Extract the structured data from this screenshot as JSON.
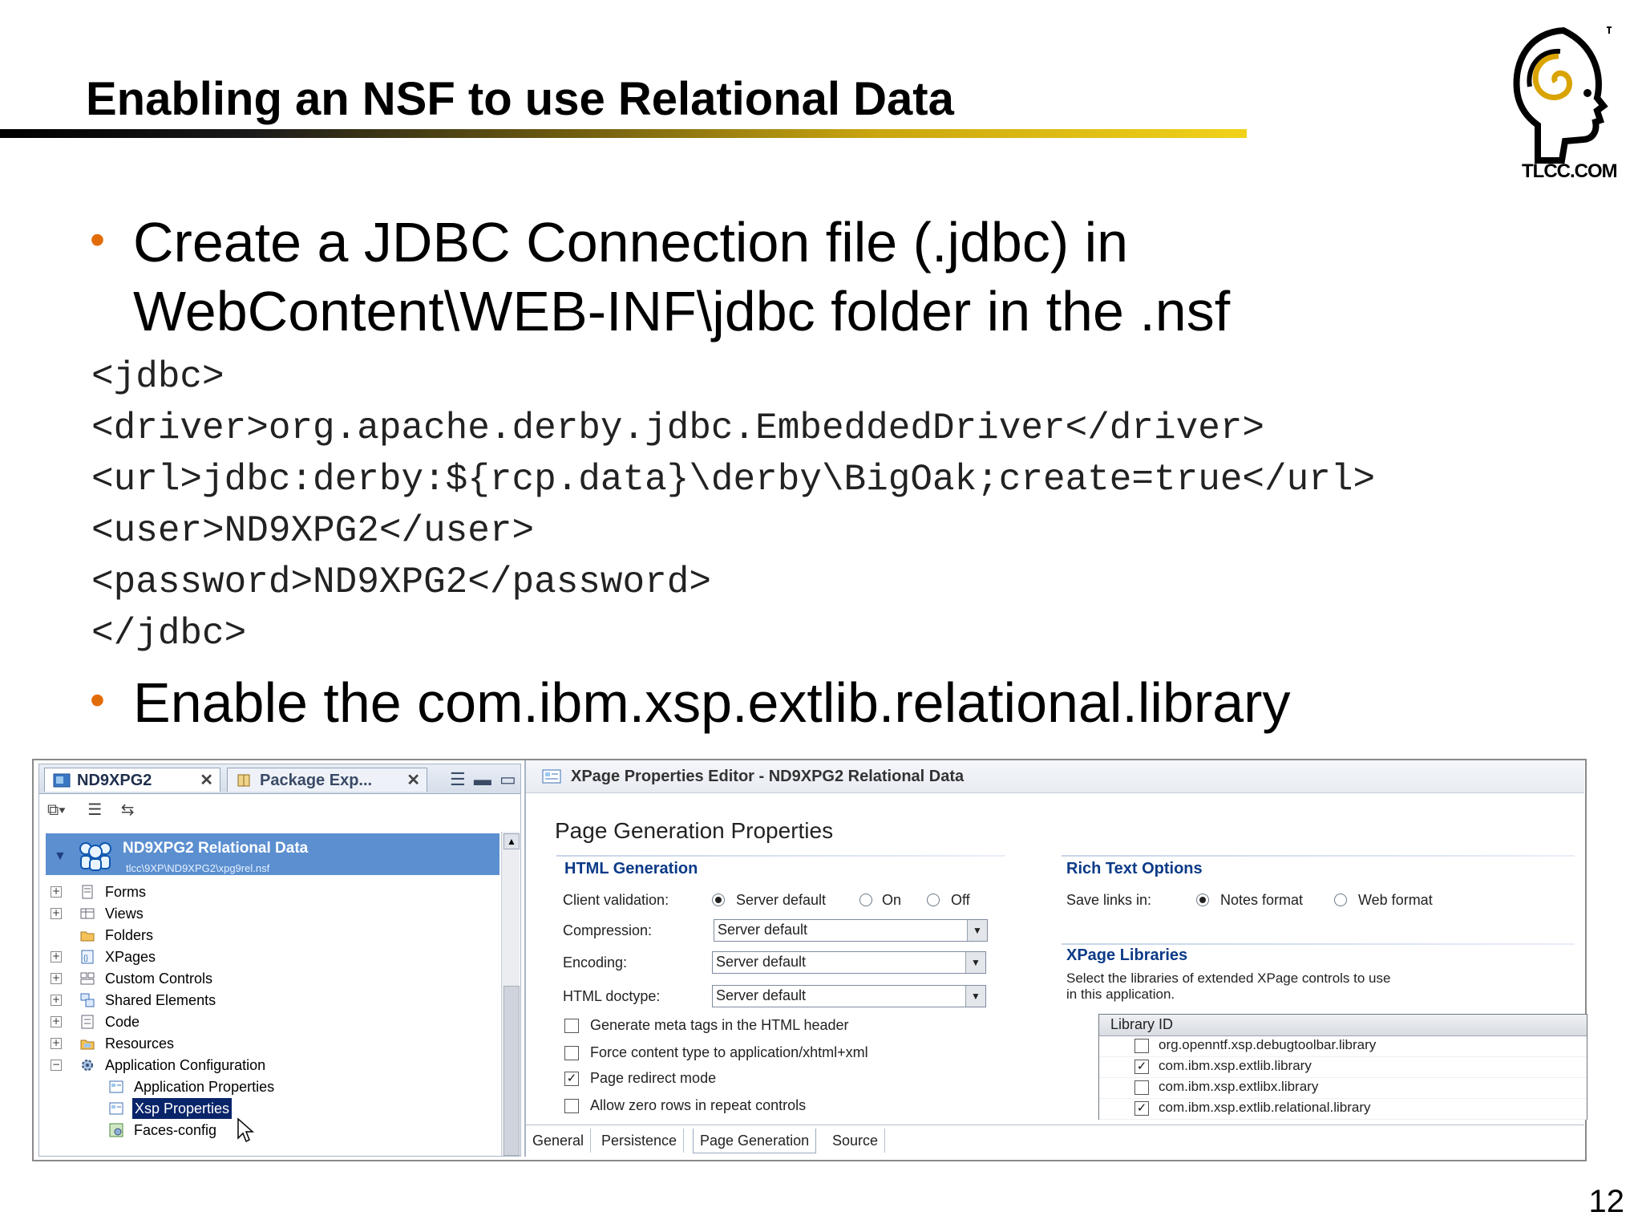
{
  "slide": {
    "title": "Enabling an NSF to use Relational Data",
    "logo_text": "TLCC.COM",
    "bullet1_line1": "Create a JDBC Connection file (.jdbc)  in",
    "bullet1_line2": "WebContent\\WEB-INF\\jdbc folder in the .nsf",
    "code_lines": [
      "<jdbc>",
      "<driver>org.apache.derby.jdbc.EmbeddedDriver</driver>",
      "<url>jdbc:derby:${rcp.data}\\derby\\BigOak;create=true</url>",
      "<user>ND9XPG2</user>",
      "<password>ND9XPG2</password>",
      "</jdbc>"
    ],
    "bullet2": "Enable the com.ibm.xsp.extlib.relational.library",
    "page_number": "12",
    "colors": {
      "bullet": "#e36c0a",
      "selection": "#0a246a",
      "section_title": "#0c3a87"
    }
  },
  "navigator": {
    "tab1": "ND9XPG2",
    "tab2": "Package Exp...",
    "app_title": "ND9XPG2 Relational Data",
    "app_path": "tlcc\\9XP\\ND9XPG2\\xpg9rel.nsf",
    "items": [
      {
        "label": "Forms",
        "icon": "form-icon"
      },
      {
        "label": "Views",
        "icon": "view-icon"
      },
      {
        "label": "Folders",
        "icon": "folder-icon"
      },
      {
        "label": "XPages",
        "icon": "xpages-icon"
      },
      {
        "label": "Custom Controls",
        "icon": "custom-controls-icon"
      },
      {
        "label": "Shared Elements",
        "icon": "shared-elements-icon"
      },
      {
        "label": "Code",
        "icon": "code-icon"
      },
      {
        "label": "Resources",
        "icon": "resources-icon"
      },
      {
        "label": "Application Configuration",
        "icon": "gear-icon"
      },
      {
        "label": "Application Properties",
        "icon": "properties-icon"
      },
      {
        "label": "Xsp Properties",
        "icon": "properties-icon"
      },
      {
        "label": "Faces-config",
        "icon": "gear-icon"
      }
    ]
  },
  "editor": {
    "title": "XPage Properties Editor - ND9XPG2 Relational Data",
    "page_title": "Page Generation Properties",
    "html_generation": {
      "title": "HTML Generation",
      "client_validation_label": "Client validation:",
      "client_validation_options": [
        "Server default",
        "On",
        "Off"
      ],
      "client_validation_selected": "Server default",
      "compression_label": "Compression:",
      "compression_value": "Server default",
      "encoding_label": "Encoding:",
      "encoding_value": "Server default",
      "doctype_label": "HTML doctype:",
      "doctype_value": "Server default",
      "checkboxes": [
        {
          "label": "Generate meta tags in the HTML header",
          "checked": false
        },
        {
          "label": "Force content type to application/xhtml+xml",
          "checked": false
        },
        {
          "label": "Page redirect mode",
          "checked": true
        },
        {
          "label": "Allow zero rows in repeat controls",
          "checked": false
        }
      ]
    },
    "rich_text": {
      "title": "Rich Text Options",
      "save_links_label": "Save links in:",
      "options": [
        "Notes format",
        "Web format"
      ],
      "selected": "Notes format"
    },
    "libraries": {
      "title": "XPage Libraries",
      "description_line1": "Select the libraries of extended XPage controls to use",
      "description_line2": "in this application.",
      "column_header": "Library ID",
      "rows": [
        {
          "id": "org.openntf.xsp.debugtoolbar.library",
          "checked": false
        },
        {
          "id": "com.ibm.xsp.extlib.library",
          "checked": true
        },
        {
          "id": "com.ibm.xsp.extlibx.library",
          "checked": false
        },
        {
          "id": "com.ibm.xsp.extlib.relational.library",
          "checked": true
        }
      ]
    },
    "tabs": [
      "General",
      "Persistence",
      "Page Generation",
      "Source"
    ],
    "active_tab": "Page Generation"
  }
}
